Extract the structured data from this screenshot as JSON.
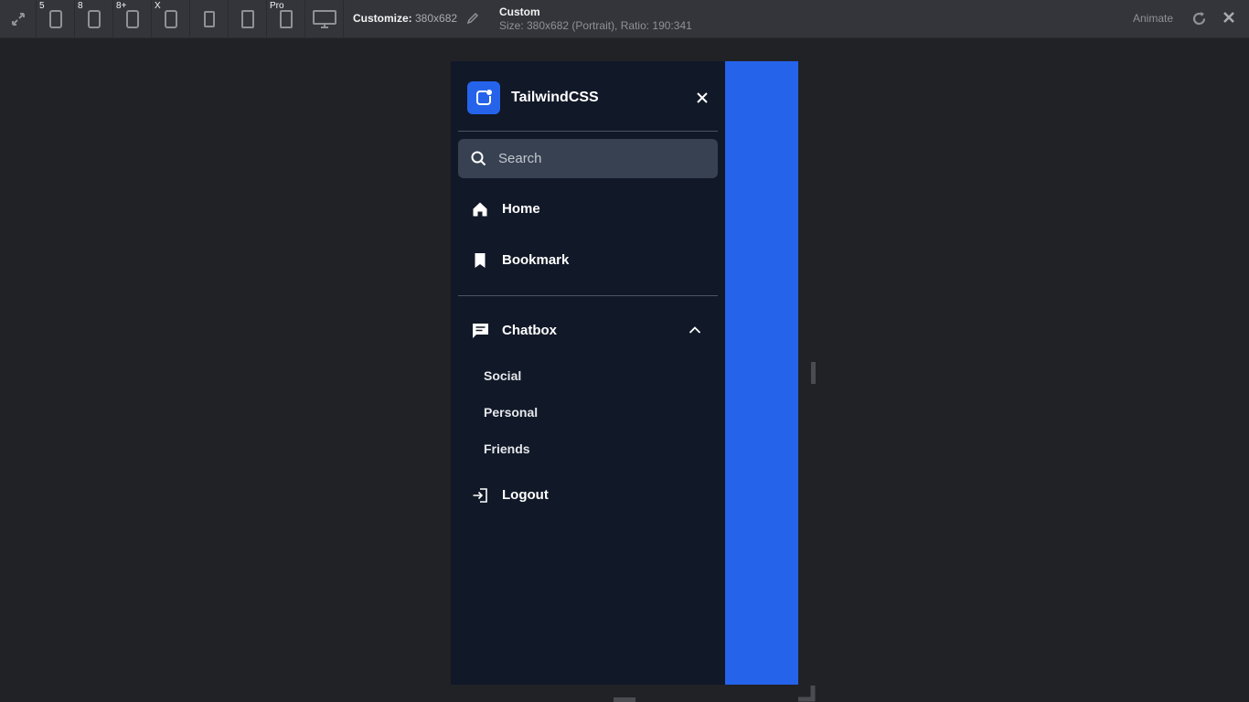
{
  "toolbar": {
    "badges": [
      "5",
      "8",
      "8+",
      "X",
      "Pro"
    ],
    "customize_label": "Customize:",
    "customize_value": " 380x682",
    "preset_title": "Custom",
    "preset_subtitle": "Size: 380x682 (Portrait), Ratio: 190:341",
    "animate_label": "Animate"
  },
  "sidebar": {
    "brand": "TailwindCSS",
    "search_placeholder": "Search",
    "nav": [
      {
        "label": "Home",
        "icon": "home-icon"
      },
      {
        "label": "Bookmark",
        "icon": "bookmark-icon"
      }
    ],
    "chatbox": {
      "label": "Chatbox",
      "icon": "chat-icon",
      "expanded": true,
      "items": [
        "Social",
        "Personal",
        "Friends"
      ]
    },
    "logout": "Logout"
  },
  "colors": {
    "accent": "#2563eb",
    "sidebar_bg": "#111827",
    "search_bg": "#374151",
    "page_bg": "#212226",
    "toolbar_bg": "#33353a"
  }
}
